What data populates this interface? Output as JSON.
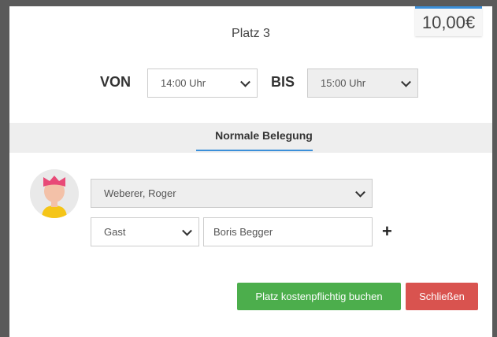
{
  "price": "10,00€",
  "title": "Platz 3",
  "time": {
    "from_label": "VON",
    "from_value": "14:00 Uhr",
    "to_label": "BIS",
    "to_value": "15:00 Uhr"
  },
  "tab": {
    "label": "Normale Belegung"
  },
  "booking": {
    "member": "Weberer, Roger",
    "guest_type": "Gast",
    "guest_name": "Boris Begger",
    "add_symbol": "+"
  },
  "buttons": {
    "book": "Platz kostenpflichtig buchen",
    "close": "Schließen"
  },
  "colors": {
    "accent": "#3b8fd9",
    "book": "#4cae4c",
    "close": "#d9534f",
    "avatar_hair": "#e84a77",
    "avatar_shirt": "#f5c518"
  }
}
